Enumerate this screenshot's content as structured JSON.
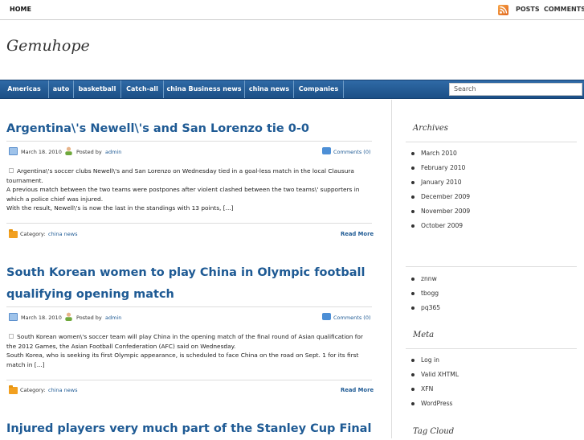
{
  "topbar": {
    "home": "HOME",
    "posts": "POSTS",
    "comments": "COMMENTS"
  },
  "site": {
    "title": "Gemuhope"
  },
  "nav": {
    "items": [
      "Americas",
      "auto",
      "basketball",
      "Catch-all",
      "china Business news",
      "china news",
      "Companies"
    ],
    "search_placeholder": "Search"
  },
  "posts": [
    {
      "title": "Argentina\\'s Newell\\'s and San Lorenzo tie 0-0",
      "date": "March 18. 2010",
      "posted_by_label": "Posted by",
      "author": "admin",
      "comments": "Comments (0)",
      "paragraphs": [
        "Argentina\\'s soccer clubs Newell\\'s and San Lorenzo on Wednesday tied in a goal-less match in the local Clausura tournament.",
        "A previous match between the two teams were postpones after violent clashed between the two teams\\' supporters in which a police chief was injured.",
        "With the result, Newell\\'s is now the last in the standings with 13 points, [...]"
      ],
      "category_label": "Category:",
      "category": "china news",
      "read_more": "Read More"
    },
    {
      "title_line1": "South Korean women to play China in Olympic football",
      "title_line2": "qualifying opening match",
      "date": "March 18. 2010",
      "posted_by_label": "Posted by",
      "author": "admin",
      "comments": "Comments (0)",
      "paragraphs": [
        "South Korean women\\'s soccer team will play China in the opening match of the final round of Asian qualification for the 2012 Games, the Asian Football Confederation (AFC) said on Wednesday.",
        "South Korea, who is seeking its first Olympic appearance, is scheduled to face China on the road on Sept. 1 for its first match in [...]"
      ],
      "category_label": "Category:",
      "category": "china news",
      "read_more": "Read More"
    },
    {
      "title": "Injured players very much part of the Stanley Cup Final"
    }
  ],
  "sidebar": {
    "archives_title": "Archives",
    "archives": [
      "March 2010",
      "February 2010",
      "January 2010",
      "December 2009",
      "November 2009",
      "October 2009"
    ],
    "links": [
      "znnw",
      "tbogg",
      "pq365"
    ],
    "meta_title": "Meta",
    "meta": [
      "Log in",
      "Valid XHTML",
      "XFN",
      "WordPress"
    ],
    "tag_cloud_title": "Tag Cloud"
  }
}
